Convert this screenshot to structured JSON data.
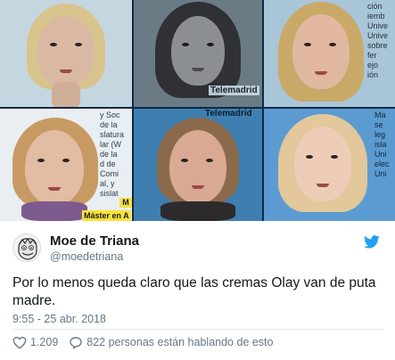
{
  "collage": {
    "tile2_caption": "Telemadrid",
    "tile1_side_text": "",
    "tile3_side_text": "ción\niemb\nUnive\nUnive\nsobre\nfer\nejo\nión",
    "tile4_side_text": "y Soc\nde la\nslatura\nlar (W\nde la\nd de\nComi\nal, y\nsislat",
    "tile4_master": "Máster en A",
    "tile4_tag": "M",
    "tile5_top_text": "Telemadrid",
    "tile6_side_text": "Ma\nse\nleg\nisla\nUni\nelec\nUni",
    "colors": {
      "bg_dark": "#0f2a45",
      "highlight_yellow": "#f7e33a"
    }
  },
  "tweet": {
    "display_name": "Moe de Triana",
    "handle": "@moedetriana",
    "text": "Por lo menos queda claro que las cremas Olay van de puta madre.",
    "timestamp": "9:55 - 25 abr. 2018",
    "likes": "1.209",
    "conversation": "822 personas están hablando de esto",
    "icons": {
      "platform": "twitter-bird-icon",
      "like": "heart-icon",
      "reply": "speech-bubble-icon"
    },
    "colors": {
      "accent": "#1da1f2",
      "text": "#14171a",
      "secondary": "#657786"
    }
  }
}
